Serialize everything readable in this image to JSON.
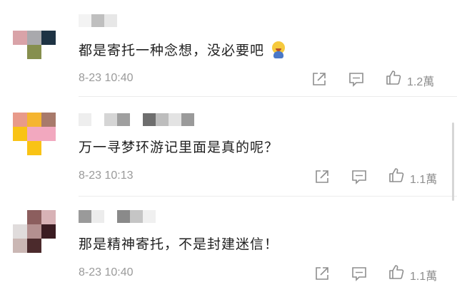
{
  "comments": [
    {
      "text": "都是寄托一种念想，没必要吧",
      "has_emoji": true,
      "emoji": "sweat-smile-emoji",
      "time": "8-23 10:40",
      "likes": "1.2萬"
    },
    {
      "text": "万一寻梦环游记里面是真的呢？",
      "has_emoji": false,
      "time": "8-23 10:13",
      "likes": "1.1萬"
    },
    {
      "text": "那是精神寄托，不是封建迷信！",
      "has_emoji": false,
      "time": "8-23 10:40",
      "likes": "1.1萬"
    }
  ],
  "icons": {
    "share": "share-icon",
    "comment": "comment-icon",
    "like": "thumbs-up-icon"
  },
  "colors": {
    "text": "#1f1f1f",
    "meta": "#9a9a9a",
    "icon": "#8e8e8e"
  }
}
